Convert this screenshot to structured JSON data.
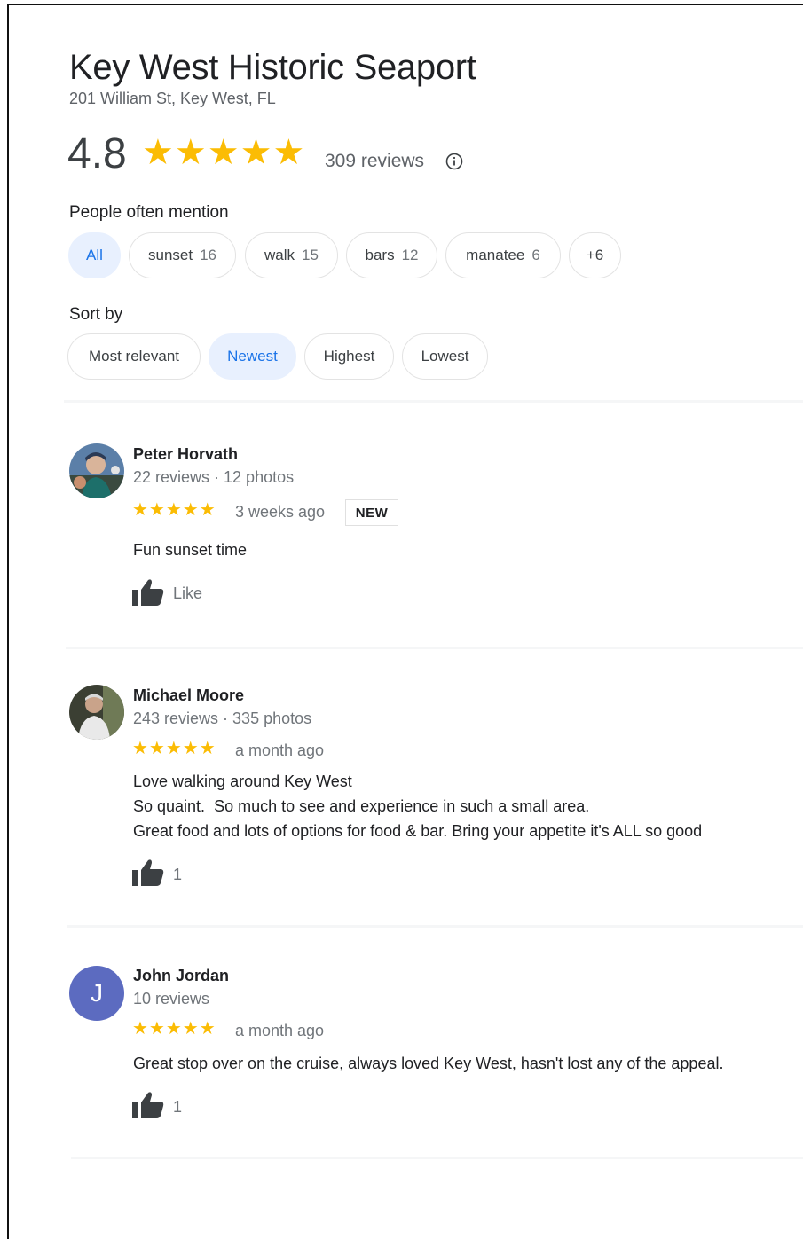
{
  "place": {
    "name": "Key West Historic Seaport",
    "address": "201 William St, Key West, FL",
    "rating": "4.8",
    "stars": "★★★★★",
    "review_count": "309 reviews"
  },
  "mentions": {
    "label": "People often mention",
    "chips": [
      {
        "label": "All",
        "count": "",
        "selected": true
      },
      {
        "label": "sunset",
        "count": "16"
      },
      {
        "label": "walk",
        "count": "15"
      },
      {
        "label": "bars",
        "count": "12"
      },
      {
        "label": "manatee",
        "count": "6"
      },
      {
        "label": "+6",
        "count": ""
      }
    ]
  },
  "sort": {
    "label": "Sort by",
    "options": [
      {
        "label": "Most relevant"
      },
      {
        "label": "Newest",
        "selected": true
      },
      {
        "label": "Highest"
      },
      {
        "label": "Lowest"
      }
    ]
  },
  "reviews": [
    {
      "name": "Peter Horvath",
      "meta": "22 reviews · 12 photos",
      "stars": "★★★★★",
      "rating": 5,
      "time": "3 weeks ago",
      "badge": "NEW",
      "lines": [
        "Fun sunset time"
      ],
      "like_label": "Like"
    },
    {
      "name": "Michael Moore",
      "meta": "243 reviews · 335 photos",
      "stars": "★★★★★",
      "rating": 5,
      "time": "a month ago",
      "lines": [
        "Love walking around Key West",
        "So quaint.  So much to see and experience in such a small area.",
        "Great food and lots of options for food & bar. Bring your appetite it's ALL so good"
      ],
      "like_label": "1"
    },
    {
      "name": "John Jordan",
      "meta": "10 reviews",
      "avatar_letter": "J",
      "stars": "★★★★★",
      "rating": 5,
      "time": "a month ago",
      "lines": [
        "Great stop over on the cruise, always loved Key West, hasn't lost any of the appeal."
      ],
      "like_label": "1"
    }
  ],
  "colors": {
    "star": "#fbbc04",
    "selected_chip_bg": "#e8f0fe",
    "selected_chip_text": "#1a73e8",
    "avatar_letter_bg": "#5c6bc0"
  },
  "icons": {
    "info": "info-icon",
    "like": "thumbs-up-icon"
  }
}
